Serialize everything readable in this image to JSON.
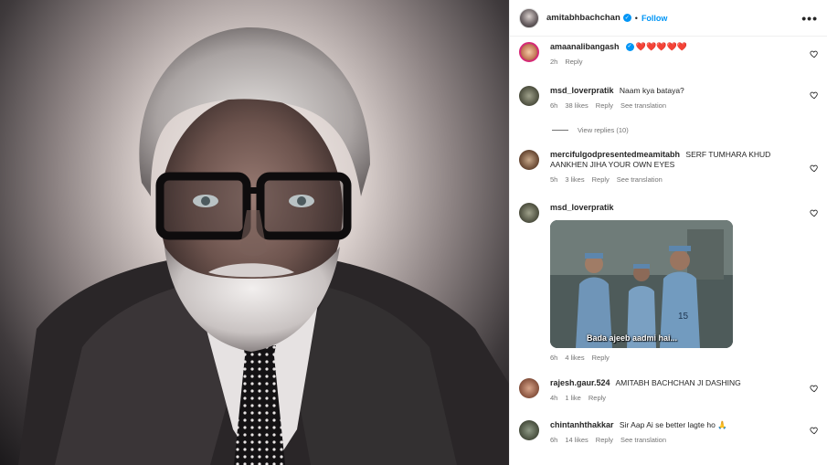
{
  "post": {
    "author": "amitabhbachchan",
    "follow_label": "Follow",
    "separator": "•",
    "more_label": "•••"
  },
  "comments": [
    {
      "username": "amaanalibangash",
      "verified": true,
      "text": "❤️❤️❤️❤️❤️",
      "time": "2h",
      "likes": "",
      "reply_label": "Reply",
      "translate": ""
    },
    {
      "username": "msd_loverpratik",
      "verified": false,
      "text": "Naam kya bataya?",
      "time": "6h",
      "likes": "38 likes",
      "reply_label": "Reply",
      "translate": "See translation"
    },
    {
      "username": "mercifulgodpresentedmeamitabh",
      "verified": false,
      "text": "SERF TUMHARA KHUD AANKHEN JIHA YOUR OWN EYES",
      "time": "5h",
      "likes": "3 likes",
      "reply_label": "Reply",
      "translate": "See translation"
    },
    {
      "username": "msd_loverpratik",
      "verified": false,
      "text": "",
      "time": "6h",
      "likes": "4 likes",
      "reply_label": "Reply",
      "translate": "",
      "gif_caption": "Bada ajeeb aadmi hai..."
    },
    {
      "username": "rajesh.gaur.524",
      "verified": false,
      "text": "AMITABH BACHCHAN JI DASHING",
      "time": "4h",
      "likes": "1 like",
      "reply_label": "Reply",
      "translate": ""
    },
    {
      "username": "chintanhthakkar",
      "verified": false,
      "text": "Sir Aap Ai se better lagte ho 🙏",
      "time": "6h",
      "likes": "14 likes",
      "reply_label": "Reply",
      "translate": "See translation"
    }
  ],
  "view_replies": "View replies (10)",
  "icons": {
    "like": "heart-outline-icon",
    "verified": "verified-badge-icon",
    "more": "more-options-icon"
  },
  "colors": {
    "accent": "#0095f6",
    "muted": "#737373",
    "text": "#262626"
  }
}
